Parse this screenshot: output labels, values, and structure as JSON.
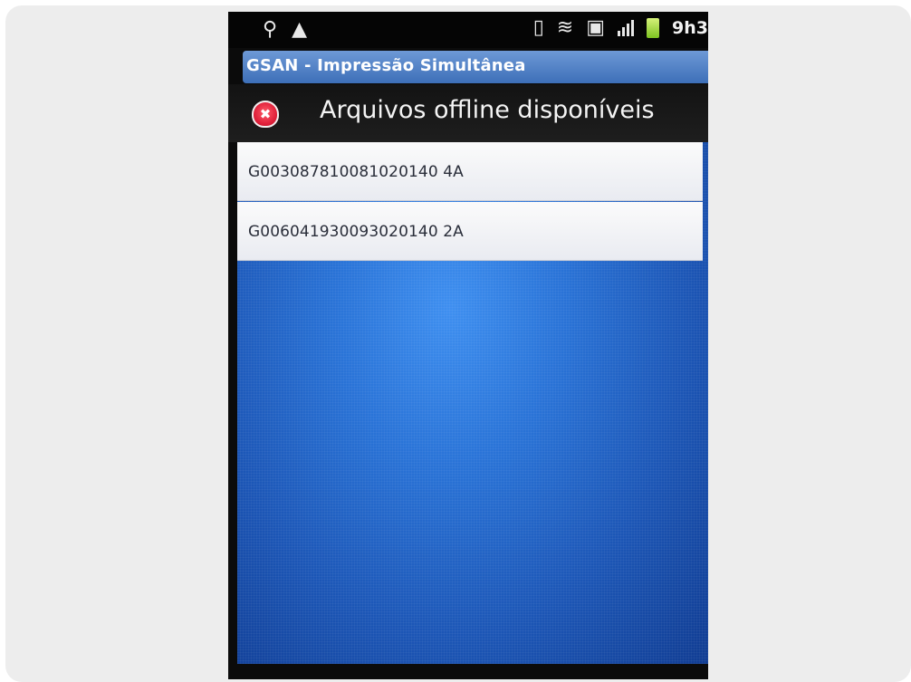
{
  "status_bar": {
    "icons_left": [
      "usb-icon",
      "warning-icon"
    ],
    "icons_right": [
      "vibrate-icon",
      "wifi-icon",
      "sdcard-icon",
      "signal-icon",
      "battery-icon"
    ],
    "time": "9h3"
  },
  "app": {
    "title": "GSAN - Impressão Simultânea"
  },
  "header": {
    "icon": "error-shield-icon",
    "title": "Arquivos offline disponíveis"
  },
  "files": [
    {
      "label": "G003087810081020140 4A"
    },
    {
      "label": "G006041930093020140 2A"
    }
  ],
  "colors": {
    "title_bar": "#4f80c6",
    "list_background": "#2266cc",
    "item_background": "#f4f5f8"
  }
}
